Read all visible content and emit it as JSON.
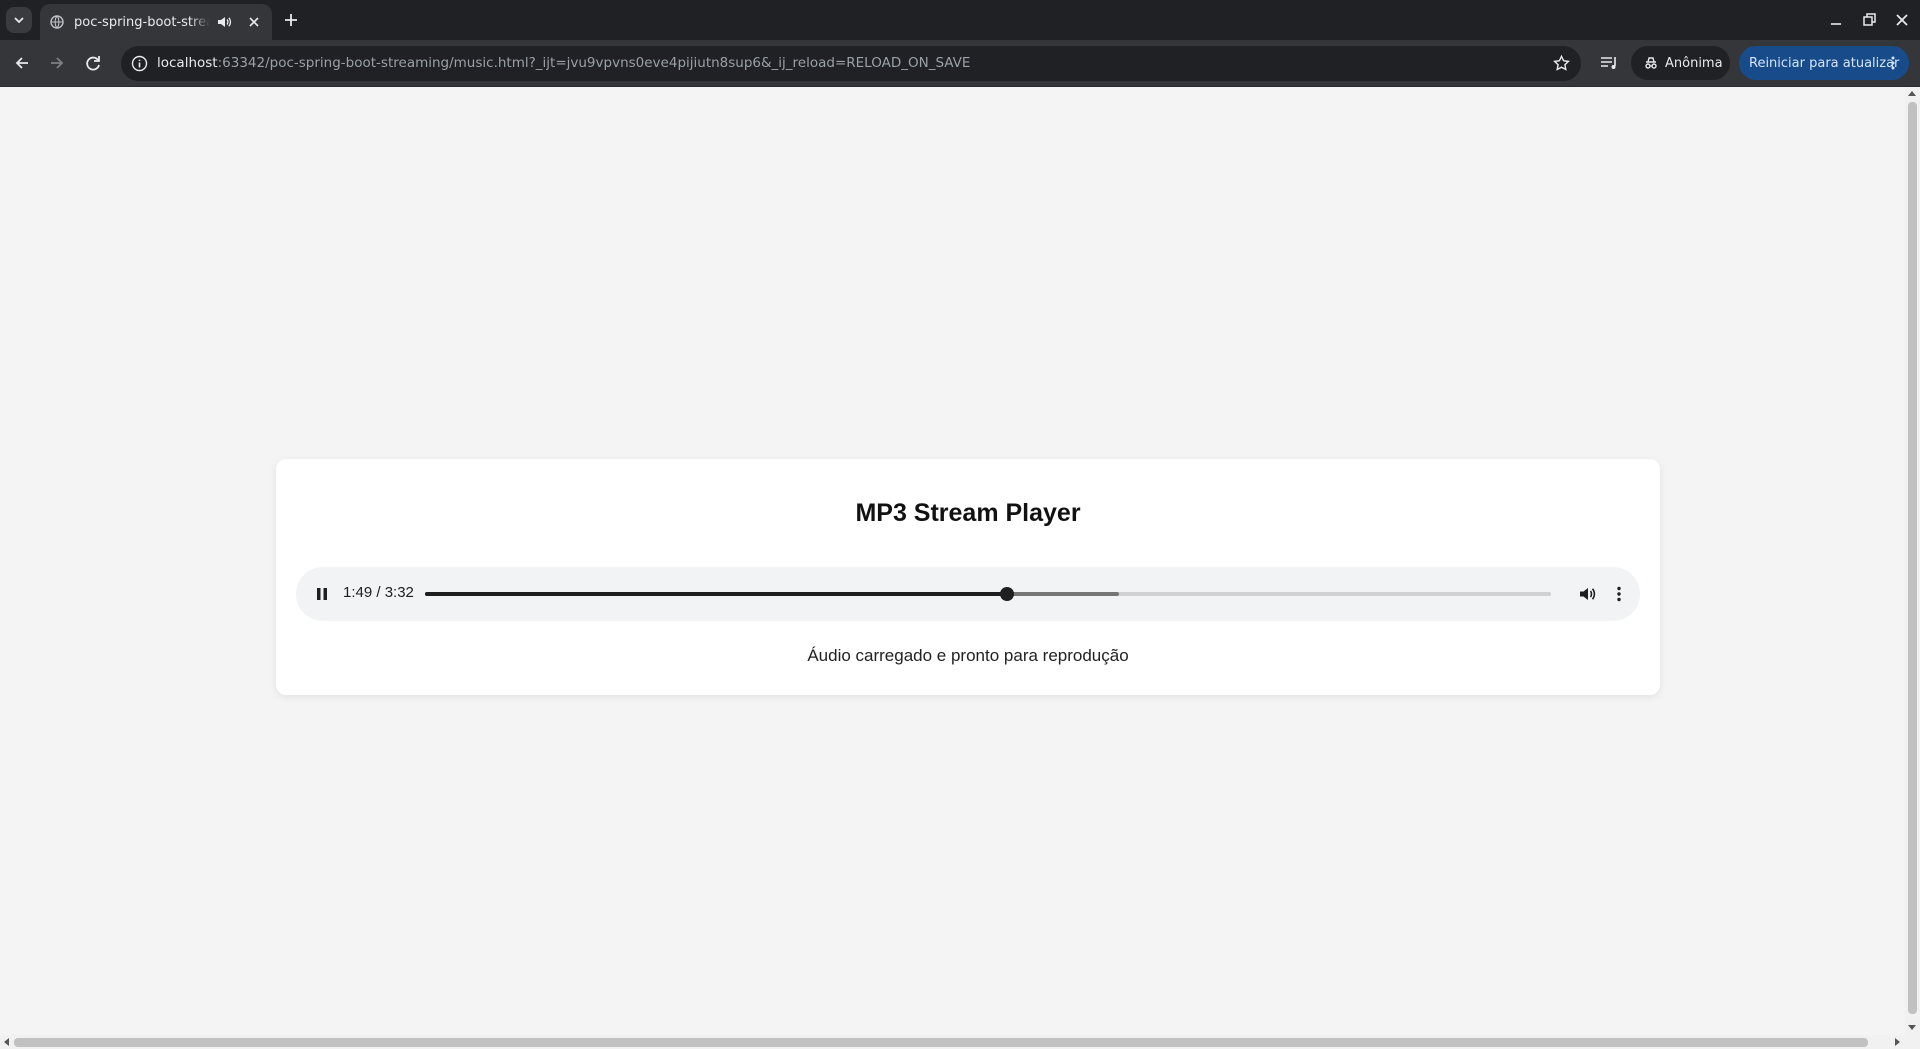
{
  "browser": {
    "tab": {
      "title": "poc-spring-boot-streaming",
      "favicon": "globe-icon",
      "audio_indicator": "speaker-icon",
      "close": "close-icon"
    },
    "new_tab": "plus-icon",
    "address": {
      "host": "localhost",
      "rest": ":63342/poc-spring-boot-streaming/music.html?_ijt=jvu9vpvns0eve4pijiutn8sup6&_ij_reload=RELOAD_ON_SAVE"
    },
    "incognito_label": "Anônima",
    "relaunch_label": "Reiniciar para atualizar",
    "accent_color": "#174b8a"
  },
  "page": {
    "title": "MP3 Stream Player",
    "player": {
      "time": "1:49 / 3:32",
      "progress": 0.5165,
      "buffered": 0.616
    },
    "status": "Áudio carregado e pronto para reprodução"
  }
}
